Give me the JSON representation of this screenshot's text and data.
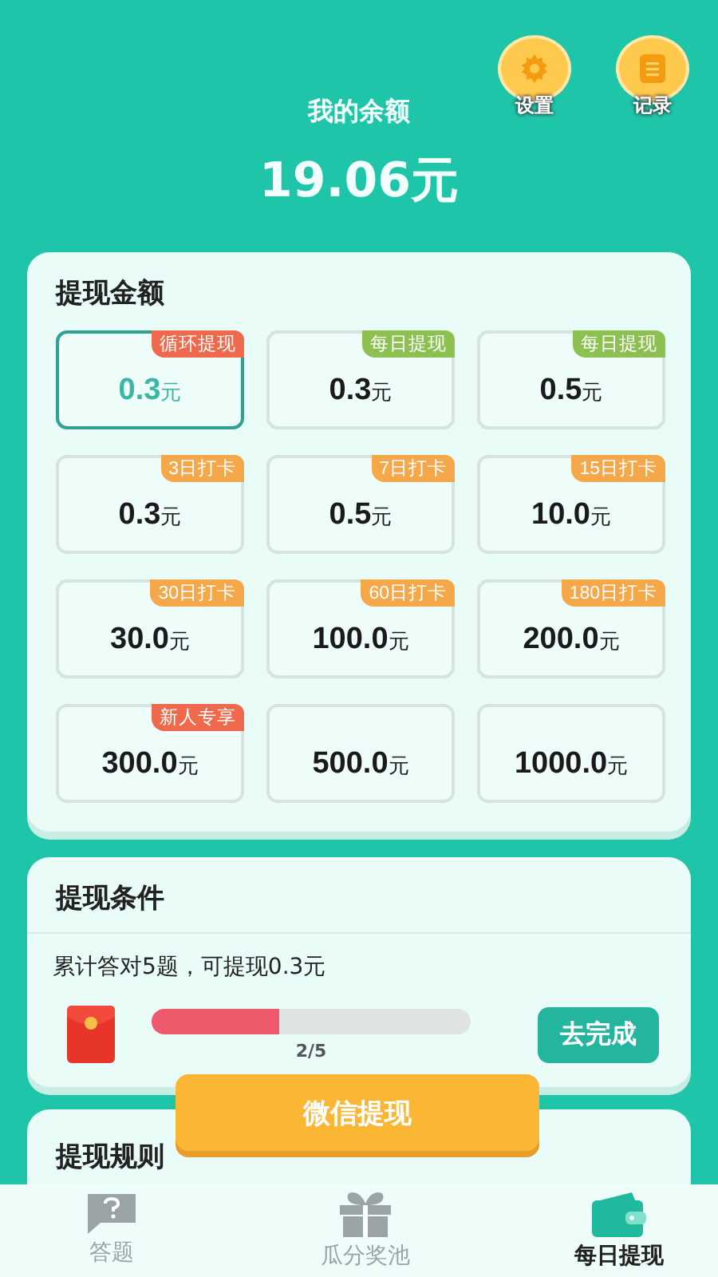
{
  "header": {
    "actions": [
      {
        "kind": "settings",
        "label": "设置"
      },
      {
        "kind": "records",
        "label": "记录"
      }
    ],
    "balance_label": "我的余额",
    "balance": "19.06元"
  },
  "amounts": {
    "title": "提现金额",
    "options": [
      {
        "tag": "循环提现",
        "color": "#ef6a4c",
        "amount": "0.3",
        "unit": "元",
        "selected": true
      },
      {
        "tag": "每日提现",
        "color": "#8cc152",
        "amount": "0.3",
        "unit": "元",
        "selected": false
      },
      {
        "tag": "每日提现",
        "color": "#8cc152",
        "amount": "0.5",
        "unit": "元",
        "selected": false
      },
      {
        "tag": "3日打卡",
        "color": "#f5a84a",
        "amount": "0.3",
        "unit": "元",
        "selected": false
      },
      {
        "tag": "7日打卡",
        "color": "#f5a84a",
        "amount": "0.5",
        "unit": "元",
        "selected": false
      },
      {
        "tag": "15日打卡",
        "color": "#f5a84a",
        "amount": "10.0",
        "unit": "元",
        "selected": false
      },
      {
        "tag": "30日打卡",
        "color": "#f5a84a",
        "amount": "30.0",
        "unit": "元",
        "selected": false
      },
      {
        "tag": "60日打卡",
        "color": "#f5a84a",
        "amount": "100.0",
        "unit": "元",
        "selected": false
      },
      {
        "tag": "180日打卡",
        "color": "#f5a84a",
        "amount": "200.0",
        "unit": "元",
        "selected": false
      },
      {
        "tag": "新人专享",
        "color": "#ef6a4c",
        "amount": "300.0",
        "unit": "元",
        "selected": false
      },
      {
        "amount": "500.0",
        "unit": "元",
        "selected": false
      },
      {
        "amount": "1000.0",
        "unit": "元",
        "selected": false
      }
    ]
  },
  "conditions": {
    "title": "提现条件",
    "description": "累计答对5题，可提现0.3元",
    "level": 0.4,
    "progress_text": "2/5",
    "button": "去完成"
  },
  "withdraw_button": "微信提现",
  "rules": {
    "title": "提现规则"
  },
  "tabs": [
    {
      "kind": "question",
      "label": "答题",
      "selected": false
    },
    {
      "kind": "gift",
      "label": "瓜分奖池",
      "selected": false
    },
    {
      "kind": "wallet",
      "label": "每日提现",
      "selected": true
    }
  ]
}
